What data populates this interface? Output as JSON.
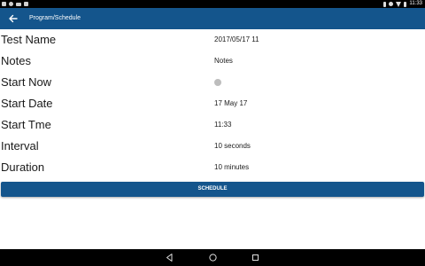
{
  "status_bar": {
    "time": "11:33",
    "left_icons": [
      "app-notification-icon",
      "settings-notification-icon",
      "screenshot-notification-icon",
      "image-notification-icon"
    ],
    "right_icons": [
      "bluetooth-icon",
      "alarm-icon",
      "wifi-icon",
      "battery-icon"
    ]
  },
  "app_bar": {
    "back_icon": "back-arrow-icon",
    "title": "Program/Schedule",
    "color": "#14558c"
  },
  "form": {
    "rows": [
      {
        "label": "Test Name",
        "value": "2017/05/17 11"
      },
      {
        "label": "Notes",
        "value": "Notes"
      },
      {
        "label": "Start Now",
        "toggle_state": "off"
      },
      {
        "label": "Start Date",
        "value": "17 May 17"
      },
      {
        "label": "Start Tme",
        "value": "11:33"
      },
      {
        "label": "Interval",
        "value": "10 seconds"
      },
      {
        "label": "Duration",
        "value": "10 minutes"
      }
    ]
  },
  "schedule_button": {
    "label": "SCHEDULE",
    "color": "#14558c"
  },
  "nav_bar": {
    "icons": [
      "nav-back-icon",
      "nav-home-icon",
      "nav-recent-apps-icon"
    ]
  }
}
